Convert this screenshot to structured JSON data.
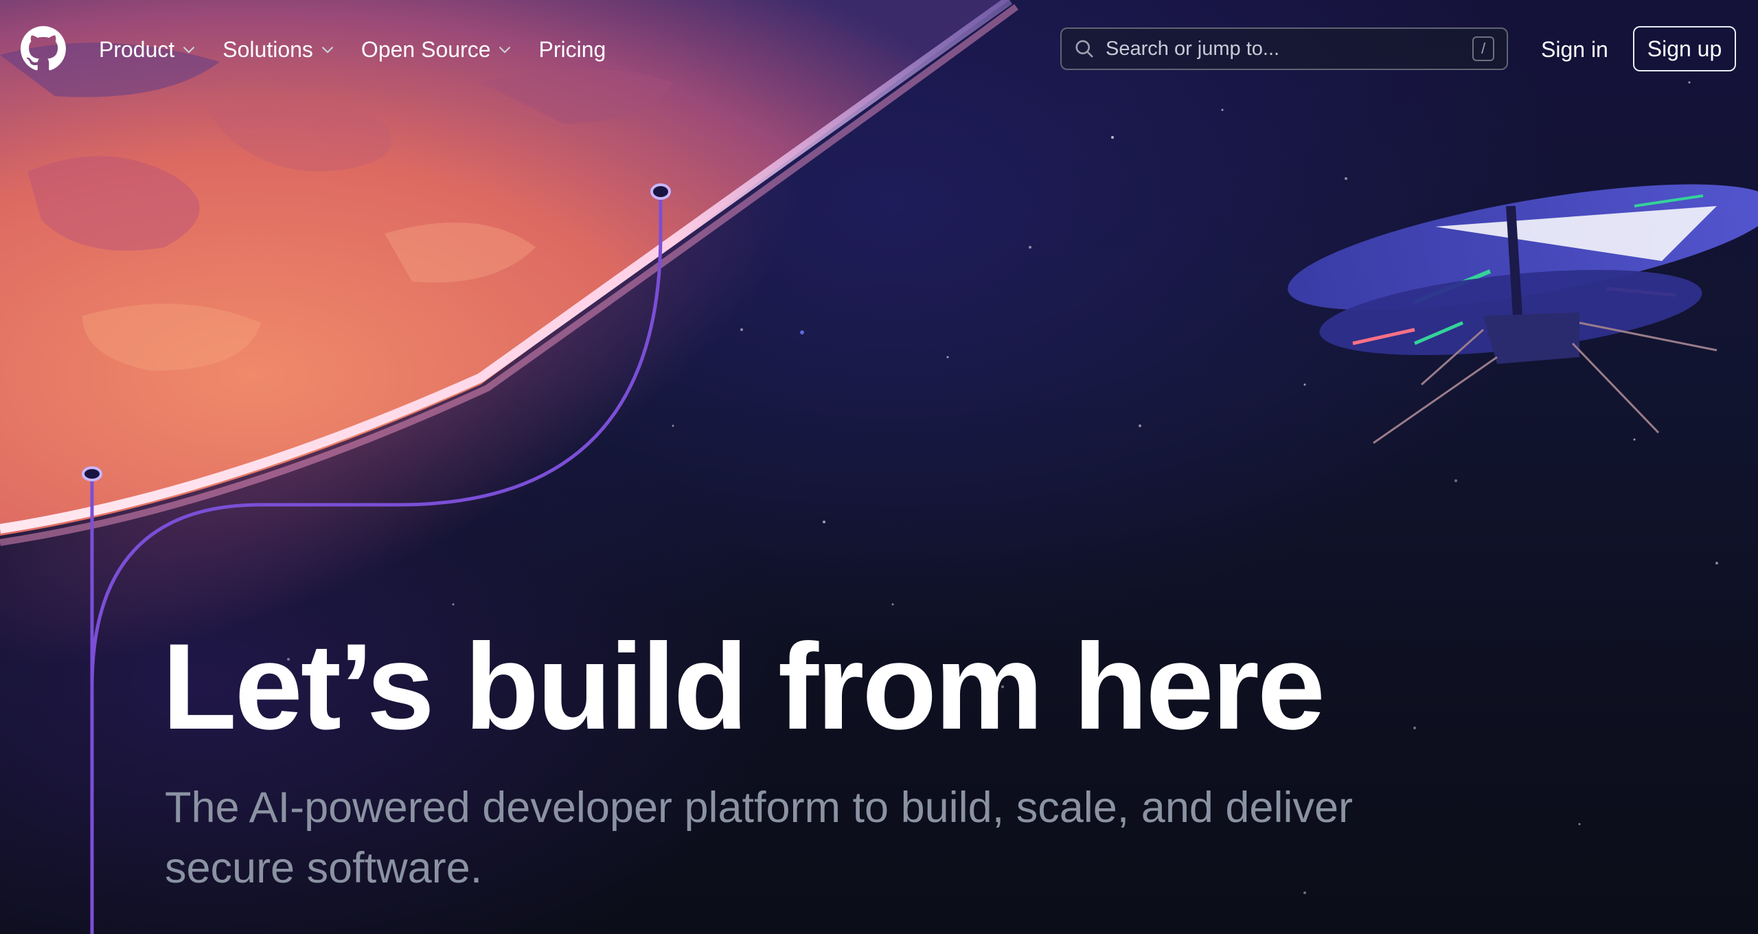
{
  "header": {
    "logo_icon": "github-mark-icon",
    "nav": [
      {
        "label": "Product",
        "has_dropdown": true
      },
      {
        "label": "Solutions",
        "has_dropdown": true
      },
      {
        "label": "Open Source",
        "has_dropdown": true
      },
      {
        "label": "Pricing",
        "has_dropdown": false
      }
    ],
    "search": {
      "placeholder": "Search or jump to...",
      "shortcut_key": "/",
      "icon": "search-icon"
    },
    "sign_in_label": "Sign in",
    "sign_up_label": "Sign up"
  },
  "hero": {
    "title": "Let’s build from here",
    "subtitle": "The AI-powered developer platform to build, scale, and deliver secure software."
  },
  "colors": {
    "background": "#0d1117",
    "planet": "#e8735e",
    "path_line": "#7b4fd6",
    "subtitle_text": "#8b93a3"
  }
}
